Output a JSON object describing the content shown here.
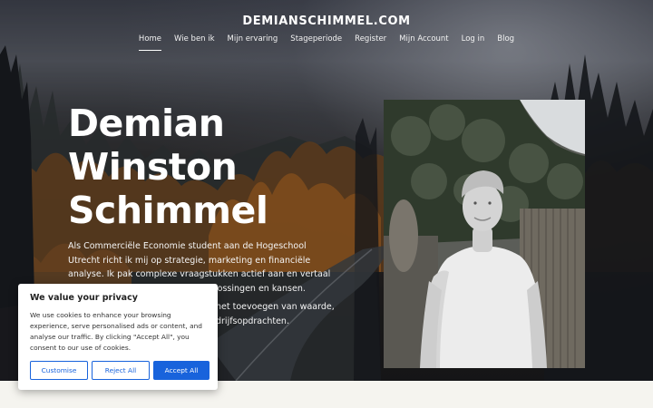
{
  "site": {
    "brand": "DEMIANSCHIMMEL.COM"
  },
  "nav": {
    "items": [
      {
        "label": "Home",
        "active": true
      },
      {
        "label": "Wie ben ik",
        "active": false
      },
      {
        "label": "Mijn ervaring",
        "active": false
      },
      {
        "label": "Stageperiode",
        "active": false
      },
      {
        "label": "Register",
        "active": false
      },
      {
        "label": "Mijn Account",
        "active": false
      },
      {
        "label": "Log in",
        "active": false
      },
      {
        "label": "Blog",
        "active": false
      }
    ]
  },
  "hero": {
    "name_lines": [
      "Demian",
      "Winston",
      "Schimmel"
    ],
    "paragraph1": "Als Commerciële Economie student aan de Hogeschool Utrecht richt ik mij op strategie, marketing en financiële analyse. Ik pak complexe vraagstukken actief aan en vertaal ze naar concrete, commerciële",
    "paragraph1_tail": "oplossingen en kansen.",
    "paragraph2": "het toevoegen van waarde,",
    "paragraph2_line2": "drijfsopdrachten."
  },
  "cookie_banner": {
    "title": "We value your privacy",
    "text": "We use cookies to enhance your browsing experience, serve personalised ads or content, and analyse our traffic. By clicking \"Accept All\", you consent to our use of cookies.",
    "customise_label": "Customise",
    "reject_label": "Reject All",
    "accept_label": "Accept All",
    "accent_color": "#1863dc"
  }
}
